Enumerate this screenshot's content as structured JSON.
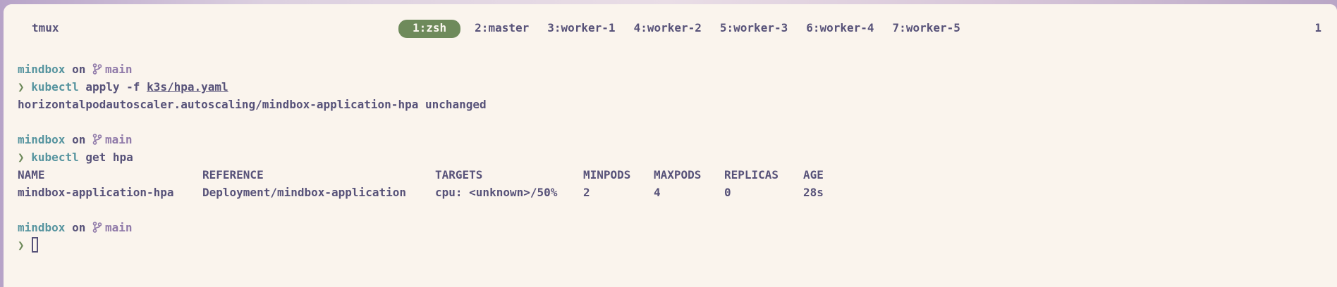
{
  "tmux": {
    "session_name": "tmux",
    "windows": [
      {
        "label": "1:zsh",
        "active": true
      },
      {
        "label": "2:master",
        "active": false
      },
      {
        "label": "3:worker-1",
        "active": false
      },
      {
        "label": "4:worker-2",
        "active": false
      },
      {
        "label": "5:worker-3",
        "active": false
      },
      {
        "label": "6:worker-4",
        "active": false
      },
      {
        "label": "7:worker-5",
        "active": false
      }
    ],
    "right_status": "1"
  },
  "terminal": {
    "blocks": [
      {
        "dir": "mindbox",
        "on": "on",
        "branch": "main",
        "prompt": "❯",
        "command": "kubectl",
        "args": "apply -f",
        "file": "k3s/hpa.yaml",
        "output": "horizontalpodautoscaler.autoscaling/mindbox-application-hpa unchanged"
      },
      {
        "dir": "mindbox",
        "on": "on",
        "branch": "main",
        "prompt": "❯",
        "command": "kubectl",
        "args": "get hpa"
      },
      {
        "dir": "mindbox",
        "on": "on",
        "branch": "main",
        "prompt": "❯"
      }
    ],
    "hpa_table": {
      "headers": [
        "NAME",
        "REFERENCE",
        "TARGETS",
        "MINPODS",
        "MAXPODS",
        "REPLICAS",
        "AGE"
      ],
      "rows": [
        [
          "mindbox-application-hpa",
          "Deployment/mindbox-application",
          "cpu: <unknown>/50%",
          "2",
          "4",
          "0",
          "28s"
        ]
      ]
    }
  },
  "colors": {
    "background": "#faf4ed",
    "foreground": "#575279",
    "dir": "#56949f",
    "branch": "#907aa9",
    "prompt": "#6e8a5b",
    "active_window_bg": "#6e8a5b"
  },
  "icons": {
    "branch": "git-branch-icon",
    "cursor": "block-cursor"
  }
}
